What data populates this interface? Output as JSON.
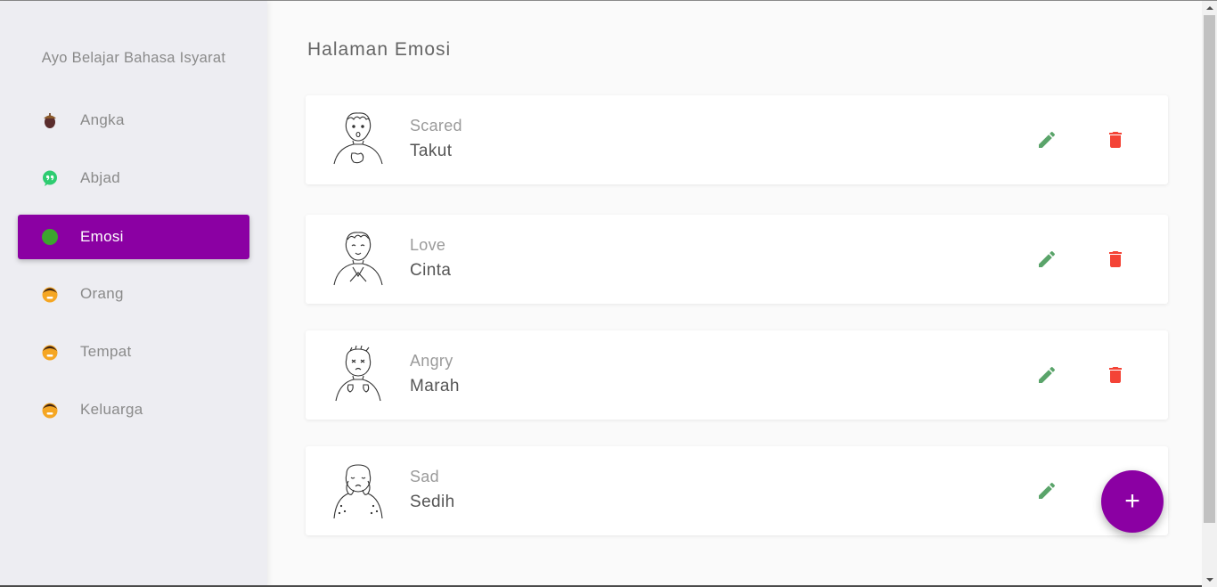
{
  "sidebar": {
    "brand": "Ayo Belajar Bahasa Isyarat",
    "items": [
      {
        "label": "Angka",
        "icon": "acorn-icon",
        "active": false
      },
      {
        "label": "Abjad",
        "icon": "chat-quote-icon",
        "active": false
      },
      {
        "label": "Emosi",
        "icon": "green-circle-icon",
        "active": true
      },
      {
        "label": "Orang",
        "icon": "person-face-icon",
        "active": false
      },
      {
        "label": "Tempat",
        "icon": "person-face-icon",
        "active": false
      },
      {
        "label": "Keluarga",
        "icon": "person-face-icon",
        "active": false
      }
    ]
  },
  "main": {
    "title": "Halaman Emosi",
    "cards": [
      {
        "sub": "Scared",
        "main": "Takut",
        "image": "scared-sign-illustration"
      },
      {
        "sub": "Love",
        "main": "Cinta",
        "image": "love-sign-illustration"
      },
      {
        "sub": "Angry",
        "main": "Marah",
        "image": "angry-sign-illustration"
      },
      {
        "sub": "Sad",
        "main": "Sedih",
        "image": "sad-sign-illustration"
      }
    ],
    "fab_label": "+"
  },
  "colors": {
    "accent": "#8b00a3",
    "edit": "#5aa46a",
    "delete": "#f44336"
  }
}
